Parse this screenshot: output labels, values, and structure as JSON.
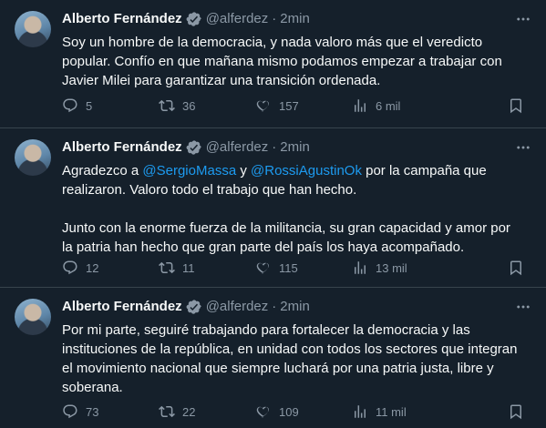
{
  "tweets": [
    {
      "author": "Alberto Fernández",
      "handle": "@alferdez",
      "separator": "·",
      "time": "2min",
      "paragraphs": [
        "Soy un hombre de la democracia, y nada valoro más que el veredicto popular. Confío en que mañana mismo podamos empezar a trabajar con Javier Milei para garantizar una transición ordenada."
      ],
      "replies": "5",
      "retweets": "36",
      "likes": "157",
      "views": "6 mil"
    },
    {
      "author": "Alberto Fernández",
      "handle": "@alferdez",
      "separator": "·",
      "time": "2min",
      "p1_a": "Agradezco a ",
      "mention1": "@SergioMassa",
      "p1_b": " y ",
      "mention2": "@RossiAgustinOk",
      "p1_c": " por la campaña que realizaron. Valoro todo el trabajo que han hecho.",
      "p2": "Junto con la enorme fuerza de la militancia, su gran capacidad y amor por la patria han hecho que gran parte del país los haya acompañado.",
      "replies": "12",
      "retweets": "11",
      "likes": "115",
      "views": "13 mil"
    },
    {
      "author": "Alberto Fernández",
      "handle": "@alferdez",
      "separator": "·",
      "time": "2min",
      "paragraphs": [
        "Por mi parte, seguiré trabajando para fortalecer la democracia y las instituciones de la república, en unidad con todos los sectores que integran el movimiento nacional que siempre luchará por una patria justa, libre y soberana."
      ],
      "replies": "73",
      "retweets": "22",
      "likes": "109",
      "views": "11 mil"
    }
  ],
  "icons": {
    "verified": "verified-badge-icon",
    "more": "more-options-icon",
    "reply": "reply-icon",
    "retweet": "retweet-icon",
    "like": "like-icon",
    "views": "views-icon",
    "share": "share-icon"
  },
  "colors": {
    "background": "#15202b",
    "text": "#f7f9f9",
    "secondary": "#8b98a5",
    "accent": "#1d9bf0",
    "border": "#38444d"
  }
}
